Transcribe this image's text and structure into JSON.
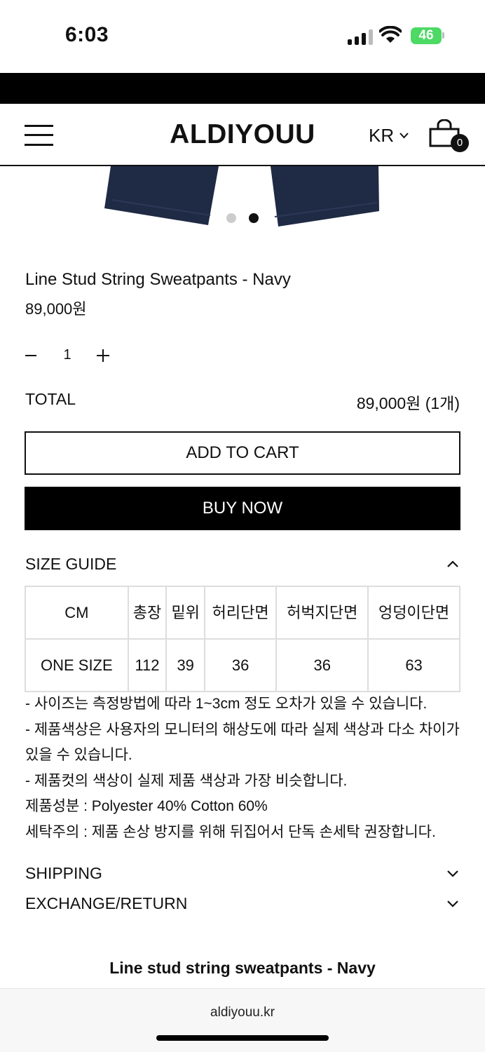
{
  "status_bar": {
    "time": "6:03",
    "battery": "46"
  },
  "header": {
    "logo": "ALDIYOUU",
    "language": "KR",
    "cart_count": "0"
  },
  "product": {
    "name": "Line Stud String Sweatpants - Navy",
    "price": "89,000원",
    "image_color": "#1f2a44",
    "carousel_dots": 2,
    "carousel_active_index": 1
  },
  "quantity": {
    "value": "1"
  },
  "total": {
    "label": "TOTAL",
    "value": "89,000원 (1개)"
  },
  "buttons": {
    "add_to_cart": "ADD TO CART",
    "buy_now": "BUY NOW"
  },
  "size_guide": {
    "title": "SIZE GUIDE",
    "columns": [
      "CM",
      "총장",
      "밑위",
      "허리단면",
      "허벅지단면",
      "엉덩이단면"
    ],
    "rows": [
      [
        "ONE SIZE",
        "112",
        "39",
        "36",
        "36",
        "63"
      ]
    ],
    "notes": [
      "- 사이즈는 측정방법에 따라 1~3cm 정도 오차가 있을 수 있습니다.",
      "- 제품색상은 사용자의 모니터의 해상도에 따라 실제 색상과 다소 차이가 있을 수 있습니다.",
      "- 제품컷의 색상이 실제 제품 색상과 가장 비슷합니다.",
      "제품성분 :  Polyester  40%  Cotton 60%",
      "세탁주의 : 제품 손상 방지를 위해 뒤집어서 단독 손세탁 권장합니다."
    ]
  },
  "accordions": {
    "shipping": "SHIPPING",
    "exchange": "EXCHANGE/RETURN"
  },
  "footer": {
    "title": "Line stud string sweatpants - Navy"
  },
  "browser": {
    "url": "aldiyouu.kr"
  }
}
